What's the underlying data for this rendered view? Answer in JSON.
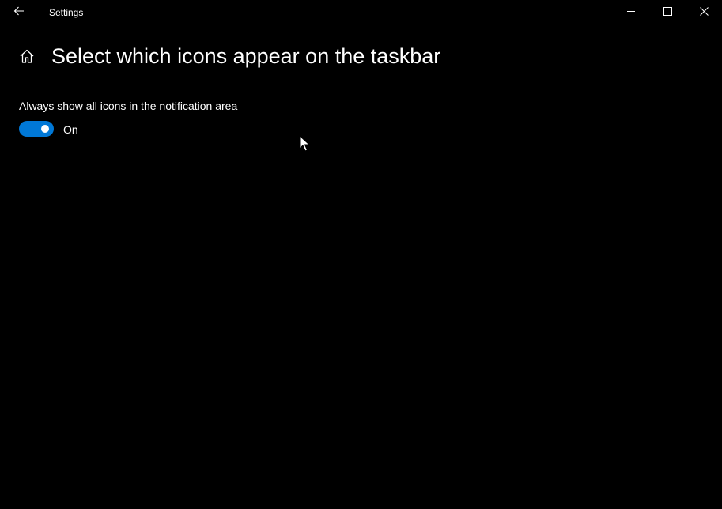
{
  "window": {
    "title": "Settings",
    "back_icon": "arrow-left-icon",
    "minimize_icon": "minimize-icon",
    "maximize_icon": "maximize-icon",
    "close_icon": "close-icon"
  },
  "header": {
    "home_icon": "home-icon",
    "title": "Select which icons appear on the taskbar"
  },
  "settings": {
    "always_show": {
      "label": "Always show all icons in the notification area",
      "state_text": "On",
      "checked": true
    }
  },
  "colors": {
    "background": "#000000",
    "accent": "#0078d7",
    "text": "#ffffff"
  }
}
